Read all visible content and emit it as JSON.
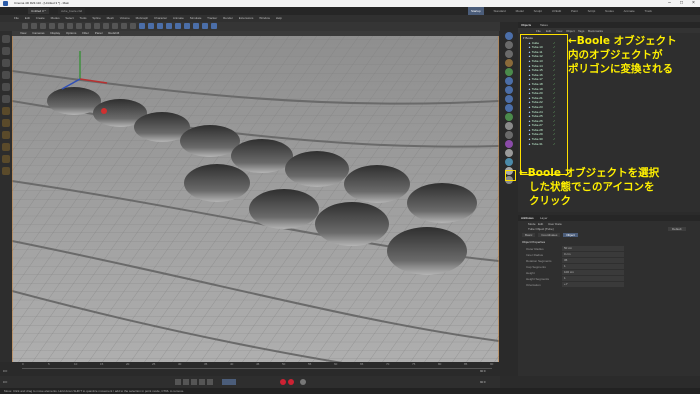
{
  "titlebar": {
    "title": "Cinema 4D R23.110 - [Untitled 3 *] - Main"
  },
  "tabs": [
    "Untitled 3 *",
    "cube_boole.c4d"
  ],
  "layouts": [
    "Startup",
    "Standard",
    "Model",
    "Sculpt",
    "UVEdit",
    "Paint",
    "Script",
    "Nodes",
    "Animate",
    "Track"
  ],
  "menus": [
    "File",
    "Edit",
    "Create",
    "Modes",
    "Select",
    "Tools",
    "Spline",
    "Mesh",
    "Volume",
    "MoGraph",
    "Character",
    "Animate",
    "Simulate",
    "Tracker",
    "Render",
    "Extensions",
    "Window",
    "Help"
  ],
  "viewport": {
    "menus": [
      "View",
      "Cameras",
      "Display",
      "Options",
      "Filter",
      "Panel",
      "Redshift"
    ],
    "label": "Perspective",
    "camera": "Default Camera"
  },
  "objects": {
    "tabs": [
      "Objects",
      "Takes"
    ],
    "menu": [
      "File",
      "Edit",
      "View",
      "Object",
      "Tags",
      "Bookmarks"
    ],
    "root": "Boole",
    "items": [
      "Cube",
      "Tube.10",
      "Tube.11",
      "Tube.12",
      "Tube.13",
      "Tube.14",
      "Tube.15",
      "Tube.16",
      "Tube.17",
      "Tube.18",
      "Tube.19",
      "Tube.20",
      "Tube.21",
      "Tube.22",
      "Tube.23",
      "Tube.24",
      "Tube.25",
      "Tube.26",
      "Tube.27",
      "Tube.28",
      "Tube.29",
      "Tube.30",
      "Tube.31"
    ]
  },
  "attributes": {
    "tabs": [
      "Attributes",
      "Layer"
    ],
    "menu": [
      "Mode",
      "Edit",
      "User Data"
    ],
    "object_name": "Tube Object [Tube]",
    "default": "Default",
    "subtabs": [
      "Basic",
      "Coordinates",
      "Object"
    ],
    "section": "Object Properties",
    "fields": [
      {
        "label": "Outer Radius",
        "value": "50 cm"
      },
      {
        "label": "Inner Radius",
        "value": "0 cm"
      },
      {
        "label": "Rotation Segments",
        "value": "36"
      },
      {
        "label": "Cap Segments",
        "value": "1"
      },
      {
        "label": "Height",
        "value": "100 cm"
      },
      {
        "label": "Height Segments",
        "value": "1"
      },
      {
        "label": "Orientation",
        "value": "+Y"
      }
    ]
  },
  "timeline": {
    "ticks": [
      "0",
      "5",
      "10",
      "15",
      "20",
      "25",
      "30",
      "35",
      "40",
      "45",
      "50",
      "55",
      "60",
      "65",
      "70",
      "75",
      "80",
      "85",
      "90"
    ],
    "start": "0 F",
    "end": "90 F",
    "current": "0 F"
  },
  "status": "Move: Click and drag to move elements. Hold down SHIFT to quantize movement / add to the selection in point mode, CTRL to remove.",
  "annotations": {
    "note1": [
      "←Boole オブジェクト",
      "内のオブジェクトが",
      "ポリゴンに変換される"
    ],
    "note2": [
      "←Boole オブジェクトを選択",
      "した状態でこのアイコンを",
      "クリック"
    ]
  }
}
